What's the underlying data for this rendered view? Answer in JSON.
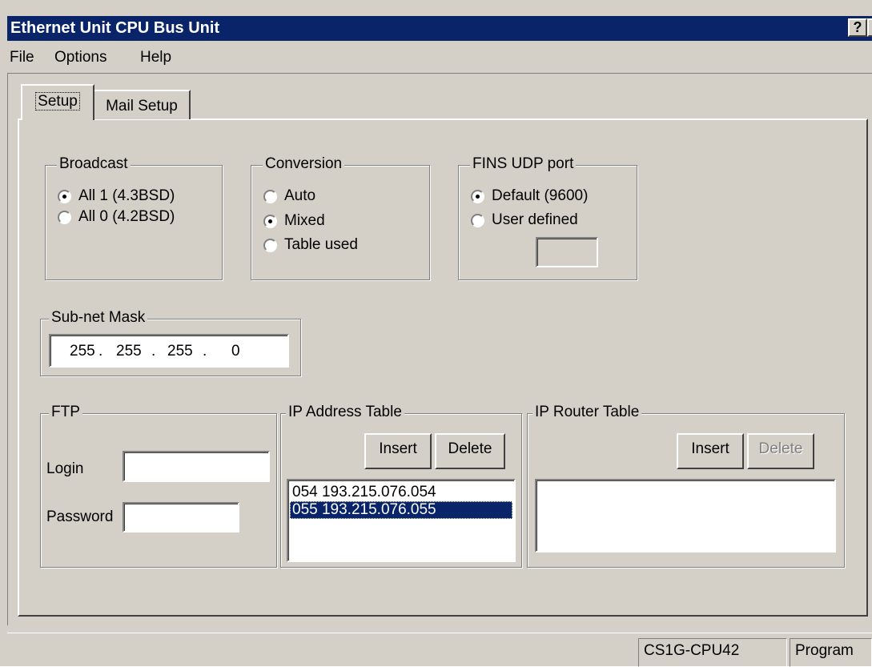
{
  "window": {
    "title": "Ethernet Unit CPU Bus Unit",
    "help_button": "?",
    "close_button": "✕"
  },
  "menu": [
    "File",
    "Options",
    "Help"
  ],
  "tabs": [
    "Setup",
    "Mail Setup"
  ],
  "broadcast": {
    "label": "Broadcast",
    "options": [
      "All 1 (4.3BSD)",
      "All 0 (4.2BSD)"
    ],
    "selected": 0
  },
  "conversion": {
    "label": "Conversion",
    "options": [
      "Auto",
      "Mixed",
      "Table used"
    ],
    "selected": 1
  },
  "fins_udp": {
    "label": "FINS UDP port",
    "options": [
      "Default (9600)",
      "User defined"
    ],
    "selected": 0,
    "value": ""
  },
  "subnet": {
    "label": "Sub-net Mask",
    "octets": [
      "255",
      "255",
      "255",
      "0"
    ],
    "separator": "."
  },
  "ftp": {
    "label": "FTP",
    "login_label": "Login",
    "login_value": "",
    "password_label": "Password",
    "password_value": ""
  },
  "ip_address_table": {
    "label": "IP Address Table",
    "insert": "Insert",
    "delete": "Delete",
    "rows": [
      "054  193.215.076.054",
      "055  193.215.076.055"
    ],
    "selected_index": 1
  },
  "ip_router_table": {
    "label": "IP Router Table",
    "insert": "Insert",
    "delete": "Delete",
    "rows": []
  },
  "status": {
    "model": "CS1G-CPU42",
    "mode": "Program"
  }
}
